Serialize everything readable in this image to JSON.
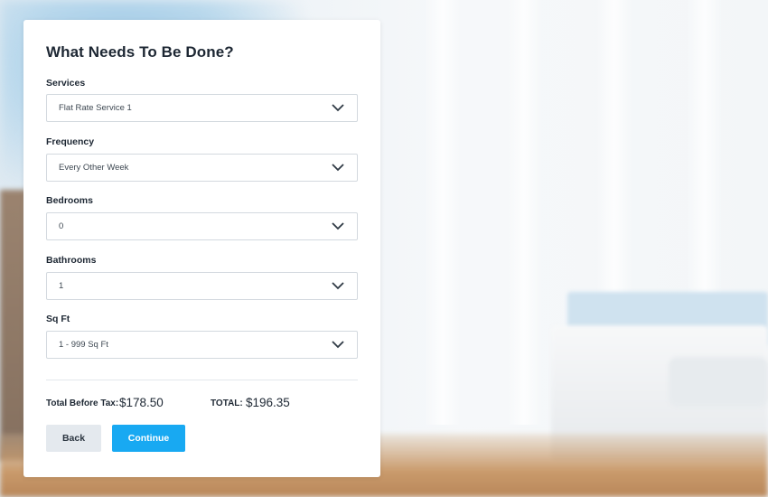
{
  "form": {
    "title": "What Needs To Be Done?",
    "fields": [
      {
        "label": "Services",
        "value": "Flat Rate Service 1"
      },
      {
        "label": "Frequency",
        "value": "Every Other Week"
      },
      {
        "label": "Bedrooms",
        "value": "0"
      },
      {
        "label": "Bathrooms",
        "value": "1"
      },
      {
        "label": "Sq Ft",
        "value": "1 - 999 Sq Ft"
      }
    ],
    "totals": {
      "before_tax_label": "Total Before Tax:",
      "before_tax_value": "$178.50",
      "total_label": "TOTAL:",
      "total_value": "$196.35"
    },
    "buttons": {
      "back": "Back",
      "continue": "Continue"
    }
  },
  "colors": {
    "accent": "#18a9f2",
    "secondary_button": "#e4e9ee",
    "text": "#1d2733"
  },
  "icons": {
    "dropdown": "chevron-down-icon"
  }
}
